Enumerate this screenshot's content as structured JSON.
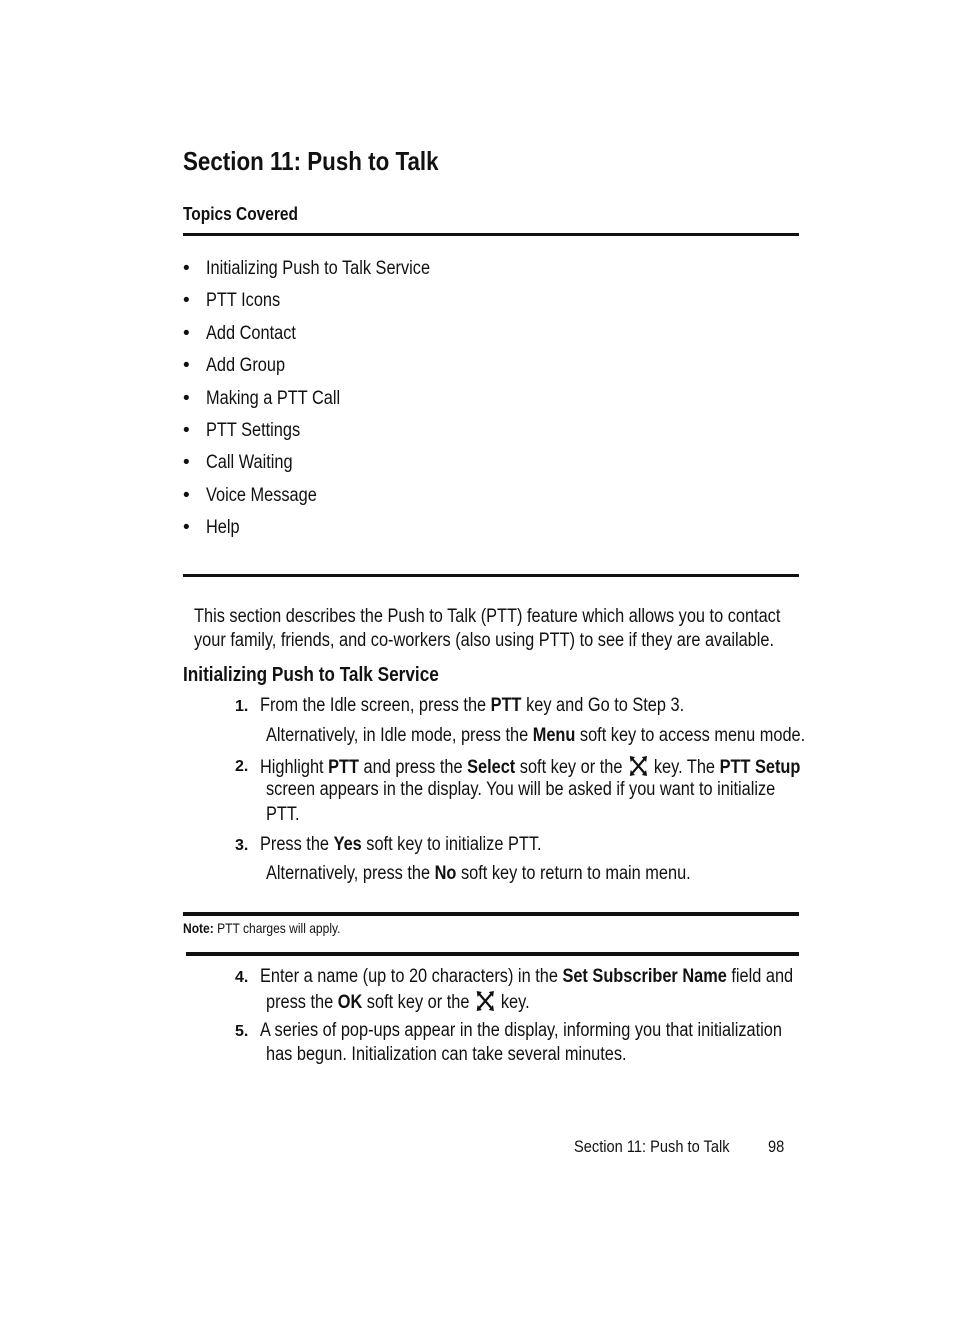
{
  "section_title": "Section 11: Push to Talk",
  "topics_heading": "Topics Covered",
  "topics": [
    "Initializing Push to Talk Service",
    "PTT Icons",
    "Add Contact",
    "Add Group",
    "Making a PTT Call",
    "PTT Settings",
    "Call Waiting",
    "Voice Message",
    "Help"
  ],
  "bullet": "•",
  "intro": {
    "line1": "This section describes the Push to Talk (PTT) feature which allows you to contact",
    "line2": "your family, friends, and co-workers (also using PTT) to see if they are available."
  },
  "subsection_heading": "Initializing Push to Talk Service",
  "steps": {
    "s1": {
      "num": "1.",
      "a": "From the Idle screen, press the ",
      "b": "PTT",
      "c": " key and Go to Step 3."
    },
    "s1_alt": {
      "a": "Alternatively, in Idle mode, press the ",
      "b": "Menu",
      "c": " soft key to access menu mode."
    },
    "s2": {
      "num": "2.",
      "a": "Highlight ",
      "b": "PTT",
      "c": " and press the ",
      "d": "Select",
      "e": " soft key or the ",
      "f": " key. The ",
      "g": "PTT Setup",
      "line2": "screen appears in the display. You will be asked if you want to initialize",
      "line3": "PTT."
    },
    "s3": {
      "num": "3.",
      "a": "Press the ",
      "b": "Yes",
      "c": " soft key to initialize PTT."
    },
    "s3_alt": {
      "a": "Alternatively, press the ",
      "b": "No",
      "c": " soft key to return to main menu."
    },
    "s4": {
      "num": "4.",
      "a": "Enter a name (up to 20 characters) in the ",
      "b": "Set Subscriber Name",
      "c": " field and",
      "d": "press the ",
      "e": "OK",
      "f": " soft key or the ",
      "g": " key."
    },
    "s5": {
      "num": "5.",
      "line1": "A series of pop-ups appear in the display, informing you that initialization",
      "line2": "has begun. Initialization can take several minutes."
    }
  },
  "note": {
    "label": "Note:",
    "text": " PTT charges will apply."
  },
  "footer": {
    "title": "Section 11: Push to Talk",
    "page": "98"
  },
  "icons": {
    "nav_key": "navigation-key-icon"
  }
}
